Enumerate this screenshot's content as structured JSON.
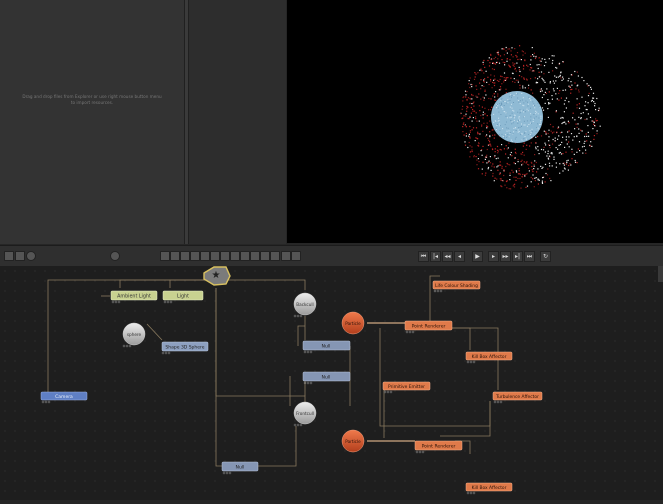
{
  "explorer": {
    "hint": "Drag and drop files from Explorer or use right mouse button menu to import resources."
  },
  "playback": {
    "buttons": [
      "to-start",
      "step-back",
      "rewind",
      "prev-frame",
      "play",
      "next-frame",
      "fast-forward",
      "step-forward",
      "to-end",
      "loop"
    ],
    "glyphs": [
      "⏮",
      "|◂",
      "◂◂",
      "◂",
      "▶",
      "▸",
      "▸▸",
      "▸|",
      "⏭",
      "↻"
    ]
  },
  "graph": {
    "root_node": "root",
    "nodes": {
      "ambient_light": "Ambient Light",
      "light": "Light",
      "sphere": "sphere",
      "shape_3d_sphere": "Shape 3D Sphere",
      "camera": "Camera",
      "backcull": "Backcull",
      "null_1": "Null",
      "null_2": "Null",
      "frontcull": "Frontcull",
      "null_3": "Null",
      "particle_1": "Particle",
      "particle_2": "Particle",
      "point_renderer_1": "Point Renderer",
      "point_renderer_2": "Point Renderer",
      "life_colour_shading": "Life Colour Shading",
      "kill_box_affector_1": "Kill Box Affector",
      "kill_box_affector_2": "Kill Box Affector",
      "primitive_emitter": "Primitive Emitter",
      "turbulence_affector": "Turbulence Affector"
    }
  },
  "colors": {
    "light_node": "#c8d190",
    "shape_node": "#8da0c0",
    "camera_node": "#5f7fc4",
    "null_node": "#8596b4",
    "particle_node": "#d9582e",
    "renderer_node": "#e07a4a",
    "wire": "#8a7a5e",
    "sphere": "#9cc4dd"
  }
}
